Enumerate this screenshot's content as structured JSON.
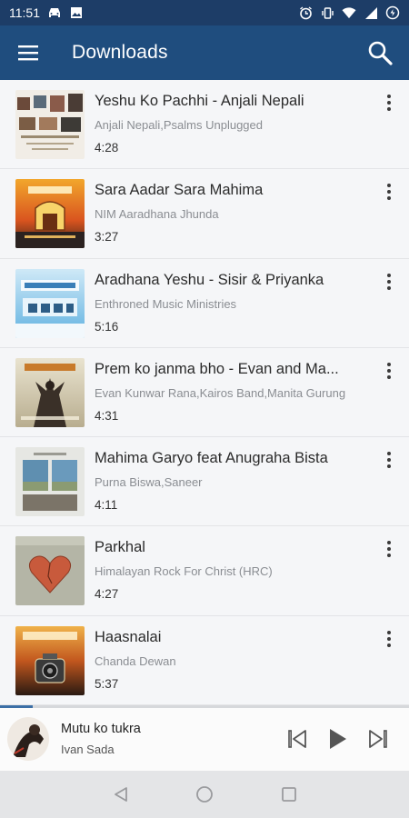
{
  "status_bar": {
    "time": "11:51"
  },
  "app_bar": {
    "title": "Downloads"
  },
  "songs": [
    {
      "title": "Yeshu Ko Pachhi - Anjali Nepali",
      "artist": "Anjali Nepali,Psalms Unplugged",
      "duration": "4:28"
    },
    {
      "title": "Sara Aadar Sara Mahima",
      "artist": "NIM Aaradhana Jhunda",
      "duration": "3:27"
    },
    {
      "title": "Aradhana Yeshu - Sisir & Priyanka",
      "artist": "Enthroned Music Ministries",
      "duration": "5:16"
    },
    {
      "title": "Prem ko janma bho - Evan and Ma...",
      "artist": "Evan Kunwar Rana,Kairos Band,Manita Gurung",
      "duration": "4:31"
    },
    {
      "title": "Mahima Garyo feat Anugraha Bista",
      "artist": "Purna Biswa,Saneer",
      "duration": "4:11"
    },
    {
      "title": "Parkhal",
      "artist": "Himalayan Rock For Christ (HRC)",
      "duration": "4:27"
    },
    {
      "title": "Haasnalai",
      "artist": "Chanda Dewan",
      "duration": "5:37"
    }
  ],
  "now_playing": {
    "title": "Mutu ko tukra",
    "artist": "Ivan Sada",
    "progress_fraction": 0.08
  },
  "colors": {
    "status_bar": "#1d3d67",
    "app_bar": "#1f4d7e",
    "list_background": "#f5f6f8",
    "progress": "#3c6fa6",
    "nav_bar": "#e4e5e7"
  }
}
